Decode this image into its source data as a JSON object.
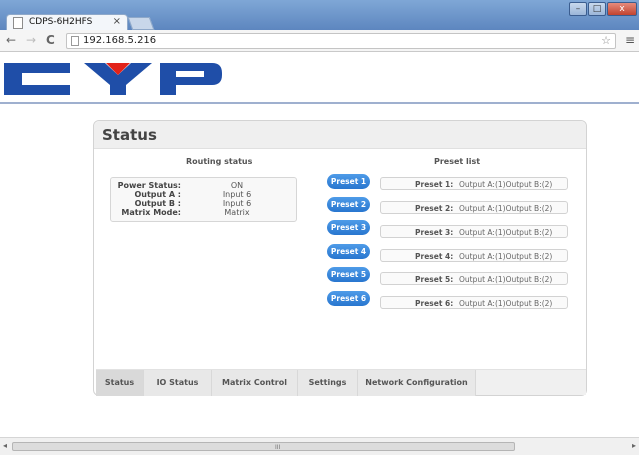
{
  "browser": {
    "tab_title": "CDPS-6H2HFS",
    "tab_close": "×",
    "url": "192.168.5.216",
    "back": "←",
    "forward": "→",
    "reload": "C",
    "star": "☆",
    "menu": "≡",
    "min": "–",
    "max": "□",
    "close": "x"
  },
  "logo": {
    "text": "CYP",
    "colors": {
      "blue": "#1f4ea8",
      "red": "#e2231a"
    }
  },
  "panel": {
    "title": "Status",
    "routing": {
      "heading": "Routing status",
      "rows": [
        {
          "label": "Power Status:",
          "value": "ON"
        },
        {
          "label": "Output A :",
          "value": "Input 6"
        },
        {
          "label": "Output B :",
          "value": "Input 6"
        },
        {
          "label": "Matrix Mode:",
          "value": "Matrix"
        }
      ]
    },
    "presets": {
      "heading": "Preset list",
      "buttons": [
        "Preset 1",
        "Preset 2",
        "Preset 3",
        "Preset 4",
        "Preset 5",
        "Preset 6"
      ],
      "items": [
        {
          "label": "Preset 1:",
          "value": "Output A:(1)Output B:(2)"
        },
        {
          "label": "Preset 2:",
          "value": "Output A:(1)Output B:(2)"
        },
        {
          "label": "Preset 3:",
          "value": "Output A:(1)Output B:(2)"
        },
        {
          "label": "Preset 4:",
          "value": "Output A:(1)Output B:(2)"
        },
        {
          "label": "Preset 5:",
          "value": "Output A:(1)Output B:(2)"
        },
        {
          "label": "Preset 6:",
          "value": "Output A:(1)Output B:(2)"
        }
      ]
    },
    "tabs": [
      "Status",
      "IO Status",
      "Matrix Control",
      "Settings",
      "Network Configuration"
    ],
    "active_tab": "Status"
  },
  "scrollbar": {
    "grip": "III",
    "left": "◂",
    "right": "▸"
  }
}
